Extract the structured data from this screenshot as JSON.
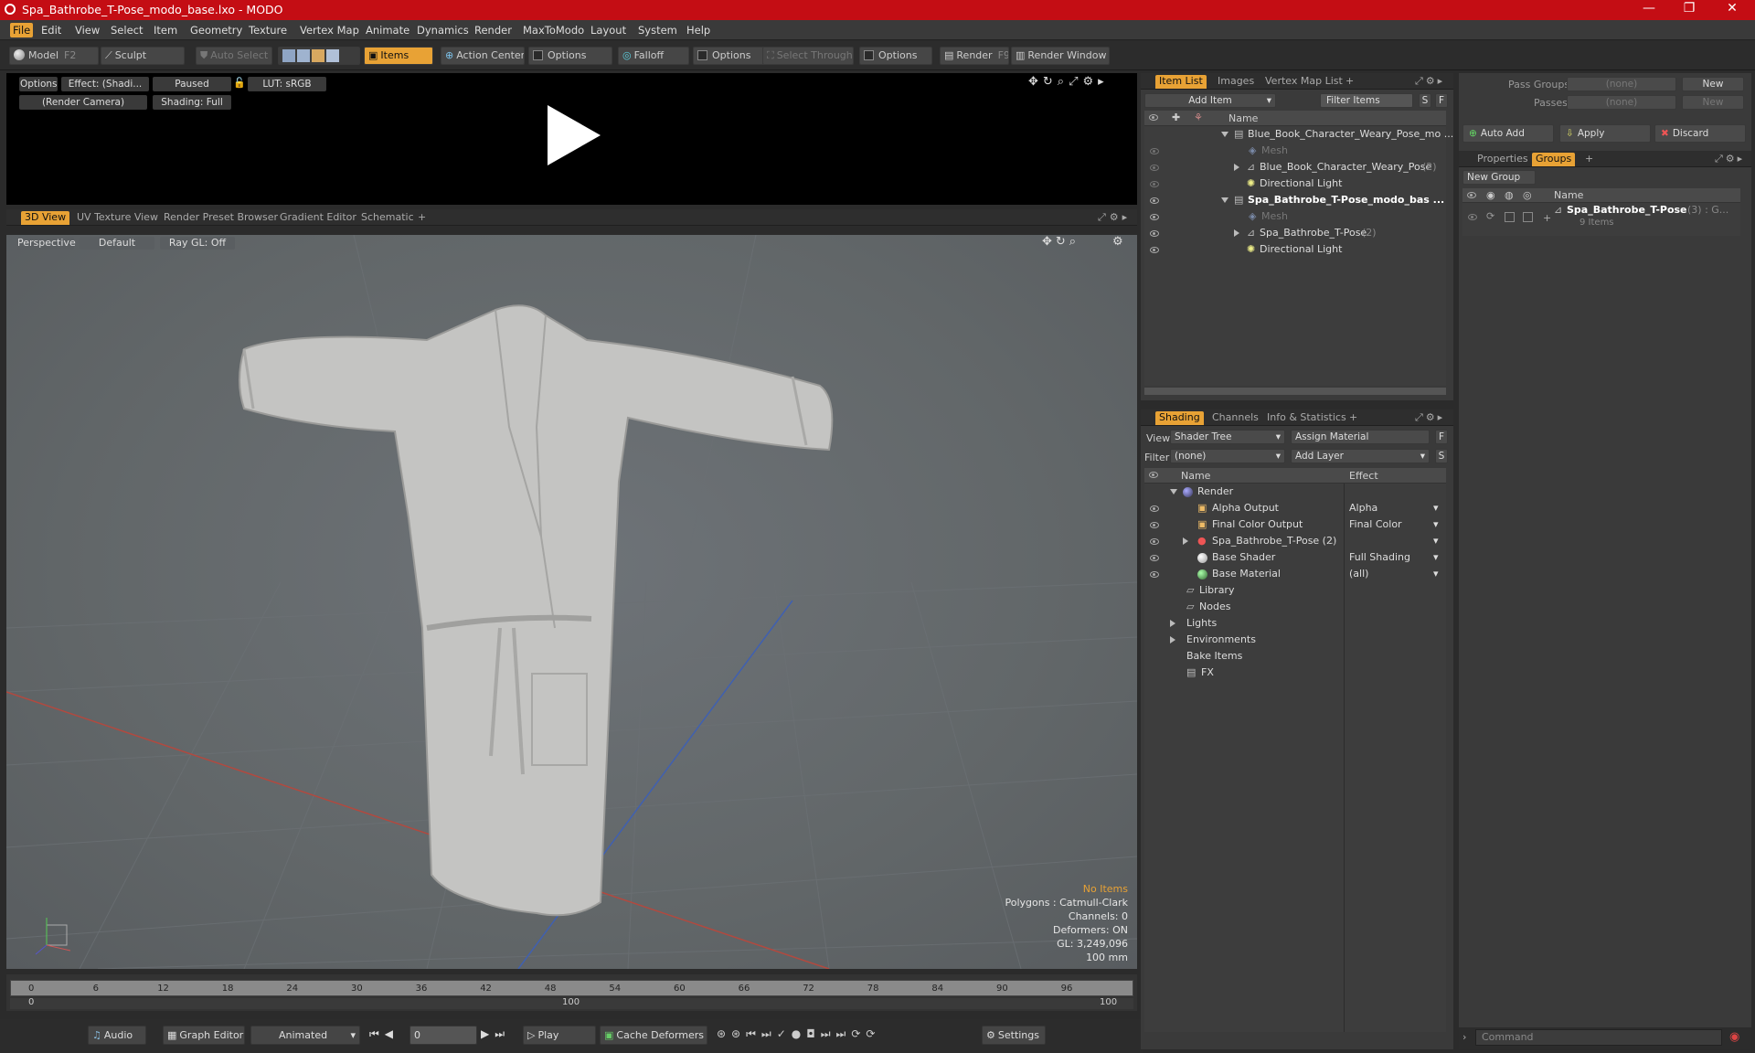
{
  "window": {
    "title": "Spa_Bathrobe_T-Pose_modo_base.lxo - MODO",
    "minimize": "—",
    "maximize": "❐",
    "close": "✕"
  },
  "menu": [
    "File",
    "Edit",
    "View",
    "Select",
    "Item",
    "Geometry",
    "Texture",
    "Vertex Map",
    "Animate",
    "Dynamics",
    "Render",
    "MaxToModo",
    "Layout",
    "System",
    "Help"
  ],
  "toolbar": {
    "model": "Model",
    "model_key": "F2",
    "sculpt": "Sculpt",
    "auto_select": "Auto Select",
    "items": "Items",
    "action_center": "Action Center",
    "options1": "Options",
    "falloff": "Falloff",
    "options2": "Options",
    "select_through": "Select Through",
    "options3": "Options",
    "render": "Render",
    "render_key": "F9",
    "render_window": "Render Window"
  },
  "preview": {
    "options": "Options",
    "effect": "Effect: (Shadi...",
    "paused": "Paused",
    "lut": "LUT: sRGB",
    "camera": "(Render Camera)",
    "shading": "Shading: Full"
  },
  "view_tabs": [
    "3D View",
    "UV Texture View",
    "Render Preset Browser",
    "Gradient Editor",
    "Schematic",
    "+"
  ],
  "viewport": {
    "perspective": "Perspective",
    "default": "Default",
    "raygl": "Ray GL: Off",
    "stats": {
      "no_items": "No Items",
      "polygons": "Polygons : Catmull-Clark",
      "channels": "Channels: 0",
      "deformers": "Deformers: ON",
      "gl": "GL: 3,249,096",
      "scale": "100 mm"
    }
  },
  "timeline": {
    "ticks": [
      "0",
      "6",
      "12",
      "18",
      "24",
      "30",
      "36",
      "42",
      "48",
      "54",
      "60",
      "66",
      "72",
      "78",
      "84",
      "90",
      "96"
    ],
    "range_start": "0",
    "range_mid": "100",
    "range_end": "100"
  },
  "bottom": {
    "audio": "Audio",
    "graph_editor": "Graph Editor",
    "animated": "Animated",
    "frame": "0",
    "play": "Play",
    "cache": "Cache Deformers",
    "settings": "Settings"
  },
  "item_list": {
    "tabs": [
      "Item List",
      "Images",
      "Vertex Map List",
      "+"
    ],
    "add_item": "Add Item",
    "filter": "Filter Items",
    "s": "S",
    "f": "F",
    "col_name": "Name",
    "rows": [
      {
        "label": "Blue_Book_Character_Weary_Pose_mo ...",
        "count": ""
      },
      {
        "label": "Mesh",
        "count": ""
      },
      {
        "label": "Blue_Book_Character_Weary_Pose",
        "count": "(2)"
      },
      {
        "label": "Directional Light",
        "count": ""
      },
      {
        "label": "Spa_Bathrobe_T-Pose_modo_bas ...",
        "count": ""
      },
      {
        "label": "Mesh",
        "count": ""
      },
      {
        "label": "Spa_Bathrobe_T-Pose",
        "count": "(2)"
      },
      {
        "label": "Directional Light",
        "count": ""
      }
    ]
  },
  "shading": {
    "tabs": [
      "Shading",
      "Channels",
      "Info & Statistics",
      "+"
    ],
    "view_label": "View",
    "view_value": "Shader Tree",
    "assign": "Assign Material",
    "f": "F",
    "filter_label": "Filter",
    "filter_value": "(none)",
    "add_layer": "Add Layer",
    "s": "S",
    "col_name": "Name",
    "col_effect": "Effect",
    "rows": [
      {
        "label": "Render",
        "effect": ""
      },
      {
        "label": "Alpha Output",
        "effect": "Alpha"
      },
      {
        "label": "Final Color Output",
        "effect": "Final Color"
      },
      {
        "label": "Spa_Bathrobe_T-Pose (2)",
        "effect": "..."
      },
      {
        "label": "Base Shader",
        "effect": "Full Shading"
      },
      {
        "label": "Base Material",
        "effect": "(all)"
      },
      {
        "label": "Library",
        "effect": ""
      },
      {
        "label": "Nodes",
        "effect": ""
      },
      {
        "label": "Lights",
        "effect": ""
      },
      {
        "label": "Environments",
        "effect": ""
      },
      {
        "label": "Bake Items",
        "effect": ""
      },
      {
        "label": "FX",
        "effect": ""
      }
    ]
  },
  "groups_panel": {
    "pass_groups": "Pass Groups",
    "pass_groups_val": "(none)",
    "new1": "New",
    "passes": "Passes",
    "passes_val": "(none)",
    "new2": "New",
    "auto_add": "Auto Add",
    "apply": "Apply",
    "discard": "Discard",
    "tabs": [
      "Properties",
      "Groups",
      "+"
    ],
    "new_group": "New Group",
    "col_name": "Name",
    "group_name": "Spa_Bathrobe_T-Pose",
    "group_count": "(3) : G...",
    "group_items": "9 Items",
    "command": "Command"
  },
  "colors": {
    "accent": "#e8a235",
    "titlebar": "#c40d14"
  }
}
